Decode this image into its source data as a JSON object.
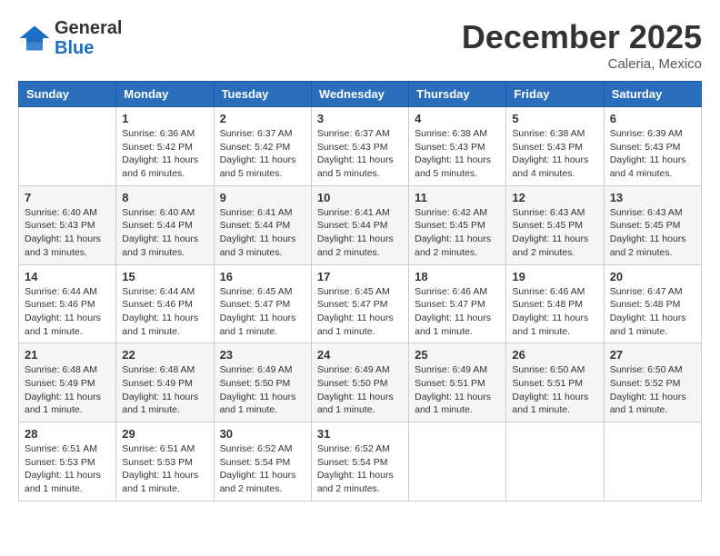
{
  "header": {
    "logo_general": "General",
    "logo_blue": "Blue",
    "month": "December 2025",
    "location": "Caleria, Mexico"
  },
  "days_of_week": [
    "Sunday",
    "Monday",
    "Tuesday",
    "Wednesday",
    "Thursday",
    "Friday",
    "Saturday"
  ],
  "weeks": [
    [
      {
        "day": "",
        "info": ""
      },
      {
        "day": "1",
        "info": "Sunrise: 6:36 AM\nSunset: 5:42 PM\nDaylight: 11 hours\nand 6 minutes."
      },
      {
        "day": "2",
        "info": "Sunrise: 6:37 AM\nSunset: 5:42 PM\nDaylight: 11 hours\nand 5 minutes."
      },
      {
        "day": "3",
        "info": "Sunrise: 6:37 AM\nSunset: 5:43 PM\nDaylight: 11 hours\nand 5 minutes."
      },
      {
        "day": "4",
        "info": "Sunrise: 6:38 AM\nSunset: 5:43 PM\nDaylight: 11 hours\nand 5 minutes."
      },
      {
        "day": "5",
        "info": "Sunrise: 6:38 AM\nSunset: 5:43 PM\nDaylight: 11 hours\nand 4 minutes."
      },
      {
        "day": "6",
        "info": "Sunrise: 6:39 AM\nSunset: 5:43 PM\nDaylight: 11 hours\nand 4 minutes."
      }
    ],
    [
      {
        "day": "7",
        "info": "Sunrise: 6:40 AM\nSunset: 5:43 PM\nDaylight: 11 hours\nand 3 minutes."
      },
      {
        "day": "8",
        "info": "Sunrise: 6:40 AM\nSunset: 5:44 PM\nDaylight: 11 hours\nand 3 minutes."
      },
      {
        "day": "9",
        "info": "Sunrise: 6:41 AM\nSunset: 5:44 PM\nDaylight: 11 hours\nand 3 minutes."
      },
      {
        "day": "10",
        "info": "Sunrise: 6:41 AM\nSunset: 5:44 PM\nDaylight: 11 hours\nand 2 minutes."
      },
      {
        "day": "11",
        "info": "Sunrise: 6:42 AM\nSunset: 5:45 PM\nDaylight: 11 hours\nand 2 minutes."
      },
      {
        "day": "12",
        "info": "Sunrise: 6:43 AM\nSunset: 5:45 PM\nDaylight: 11 hours\nand 2 minutes."
      },
      {
        "day": "13",
        "info": "Sunrise: 6:43 AM\nSunset: 5:45 PM\nDaylight: 11 hours\nand 2 minutes."
      }
    ],
    [
      {
        "day": "14",
        "info": "Sunrise: 6:44 AM\nSunset: 5:46 PM\nDaylight: 11 hours\nand 1 minute."
      },
      {
        "day": "15",
        "info": "Sunrise: 6:44 AM\nSunset: 5:46 PM\nDaylight: 11 hours\nand 1 minute."
      },
      {
        "day": "16",
        "info": "Sunrise: 6:45 AM\nSunset: 5:47 PM\nDaylight: 11 hours\nand 1 minute."
      },
      {
        "day": "17",
        "info": "Sunrise: 6:45 AM\nSunset: 5:47 PM\nDaylight: 11 hours\nand 1 minute."
      },
      {
        "day": "18",
        "info": "Sunrise: 6:46 AM\nSunset: 5:47 PM\nDaylight: 11 hours\nand 1 minute."
      },
      {
        "day": "19",
        "info": "Sunrise: 6:46 AM\nSunset: 5:48 PM\nDaylight: 11 hours\nand 1 minute."
      },
      {
        "day": "20",
        "info": "Sunrise: 6:47 AM\nSunset: 5:48 PM\nDaylight: 11 hours\nand 1 minute."
      }
    ],
    [
      {
        "day": "21",
        "info": "Sunrise: 6:48 AM\nSunset: 5:49 PM\nDaylight: 11 hours\nand 1 minute."
      },
      {
        "day": "22",
        "info": "Sunrise: 6:48 AM\nSunset: 5:49 PM\nDaylight: 11 hours\nand 1 minute."
      },
      {
        "day": "23",
        "info": "Sunrise: 6:49 AM\nSunset: 5:50 PM\nDaylight: 11 hours\nand 1 minute."
      },
      {
        "day": "24",
        "info": "Sunrise: 6:49 AM\nSunset: 5:50 PM\nDaylight: 11 hours\nand 1 minute."
      },
      {
        "day": "25",
        "info": "Sunrise: 6:49 AM\nSunset: 5:51 PM\nDaylight: 11 hours\nand 1 minute."
      },
      {
        "day": "26",
        "info": "Sunrise: 6:50 AM\nSunset: 5:51 PM\nDaylight: 11 hours\nand 1 minute."
      },
      {
        "day": "27",
        "info": "Sunrise: 6:50 AM\nSunset: 5:52 PM\nDaylight: 11 hours\nand 1 minute."
      }
    ],
    [
      {
        "day": "28",
        "info": "Sunrise: 6:51 AM\nSunset: 5:53 PM\nDaylight: 11 hours\nand 1 minute."
      },
      {
        "day": "29",
        "info": "Sunrise: 6:51 AM\nSunset: 5:53 PM\nDaylight: 11 hours\nand 1 minute."
      },
      {
        "day": "30",
        "info": "Sunrise: 6:52 AM\nSunset: 5:54 PM\nDaylight: 11 hours\nand 2 minutes."
      },
      {
        "day": "31",
        "info": "Sunrise: 6:52 AM\nSunset: 5:54 PM\nDaylight: 11 hours\nand 2 minutes."
      },
      {
        "day": "",
        "info": ""
      },
      {
        "day": "",
        "info": ""
      },
      {
        "day": "",
        "info": ""
      }
    ]
  ]
}
